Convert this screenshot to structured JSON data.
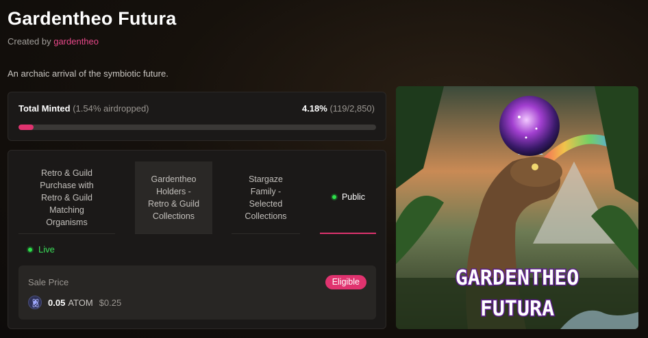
{
  "collection": {
    "title": "Gardentheo Futura",
    "created_by_label": "Created by",
    "creator": "gardentheo",
    "description": "An archaic arrival of the symbiotic future."
  },
  "minting": {
    "label": "Total Minted",
    "airdropped": "(1.54% airdropped)",
    "percent": "4.18%",
    "count": "(119/2,850)",
    "progress_fraction": 0.0418,
    "accent_color": "#e0336f"
  },
  "phases": {
    "tabs": [
      {
        "lines": [
          "Retro & Guild",
          "Purchase with",
          "Retro & Guild",
          "Matching",
          "Organisms"
        ]
      },
      {
        "lines": [
          "Gardentheo",
          "Holders -",
          "Retro & Guild",
          "Collections"
        ]
      },
      {
        "lines": [
          "Stargaze",
          "Family -",
          "Selected",
          "Collections"
        ]
      },
      {
        "label": "Public",
        "active": true
      }
    ],
    "status": "Live",
    "status_color": "#3be05a"
  },
  "sale": {
    "label": "Sale Price",
    "badge": "Eligible",
    "amount": "0.05",
    "unit": "ATOM",
    "usd": "$0.25",
    "icon": "atom-icon"
  },
  "artwork": {
    "title_line1": "GARDENTHEO",
    "title_line2": "FUTURA"
  }
}
